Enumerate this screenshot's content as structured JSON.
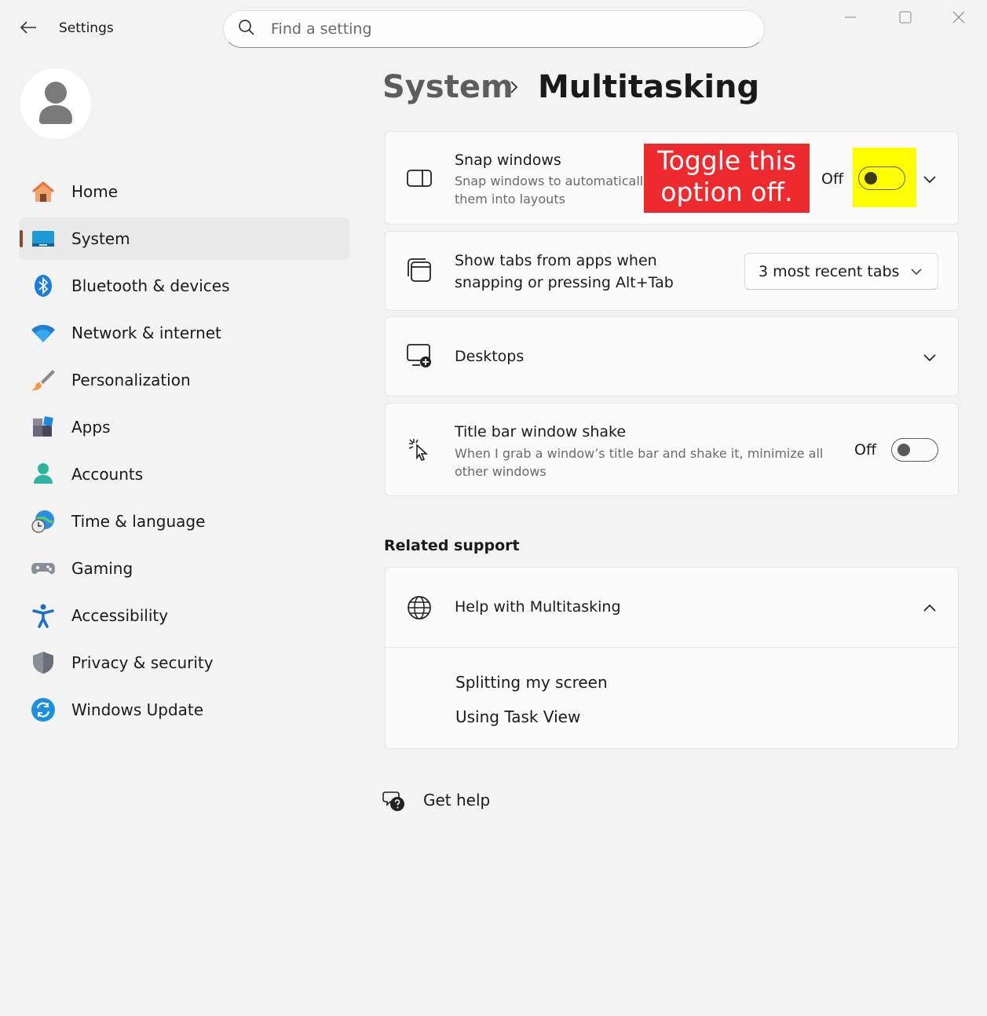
{
  "window": {
    "title": "Settings",
    "search_placeholder": "Find a setting"
  },
  "nav": {
    "items": [
      {
        "label": "Home",
        "icon": "home-icon"
      },
      {
        "label": "System",
        "icon": "system-icon",
        "active": true
      },
      {
        "label": "Bluetooth & devices",
        "icon": "bluetooth-icon"
      },
      {
        "label": "Network & internet",
        "icon": "wifi-icon"
      },
      {
        "label": "Personalization",
        "icon": "brush-icon"
      },
      {
        "label": "Apps",
        "icon": "apps-icon"
      },
      {
        "label": "Accounts",
        "icon": "accounts-icon"
      },
      {
        "label": "Time & language",
        "icon": "globe-clock-icon"
      },
      {
        "label": "Gaming",
        "icon": "gamepad-icon"
      },
      {
        "label": "Accessibility",
        "icon": "accessibility-icon"
      },
      {
        "label": "Privacy & security",
        "icon": "shield-icon"
      },
      {
        "label": "Windows Update",
        "icon": "update-icon"
      }
    ]
  },
  "breadcrumb": {
    "parent": "System",
    "current": "Multitasking"
  },
  "settings": {
    "snap": {
      "title": "Snap windows",
      "desc_line1": "Snap windows to automaticall",
      "desc_line2": "them into layouts",
      "state": "Off"
    },
    "tabs": {
      "title_line1": "Show tabs from apps when",
      "title_line2": "snapping or pressing Alt+Tab",
      "value": "3 most recent tabs"
    },
    "desktops": {
      "title": "Desktops"
    },
    "shake": {
      "title": "Title bar window shake",
      "desc_line1": "When I grab a window’s title bar and shake it, minimize all",
      "desc_line2": "other windows",
      "state": "Off"
    }
  },
  "annotation": {
    "line1": "Toggle this",
    "line2": "option off.",
    "bg_color": "#ee2a2f",
    "highlight_color": "#ffff00"
  },
  "related": {
    "title": "Related support",
    "help_title": "Help with Multitasking",
    "links": [
      "Splitting my screen",
      "Using Task View"
    ]
  },
  "get_help": "Get help"
}
